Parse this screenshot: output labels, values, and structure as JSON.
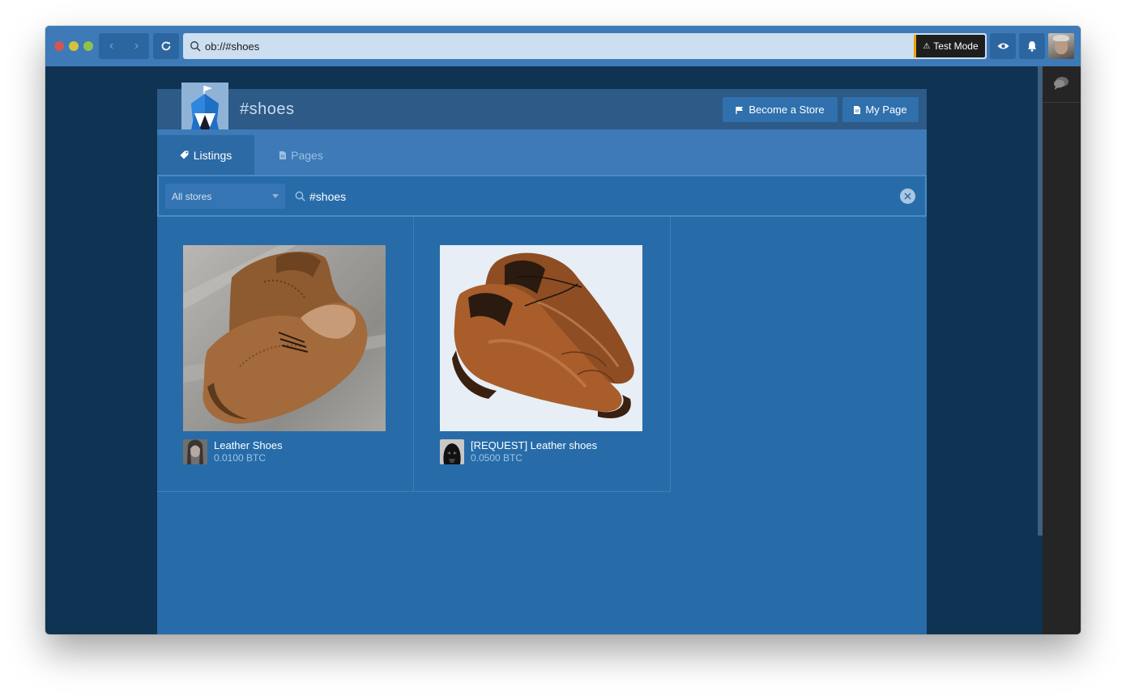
{
  "browser": {
    "address": "ob://#shoes",
    "test_mode_label": "Test Mode"
  },
  "page": {
    "title": "#shoes",
    "become_store_label": "Become a Store",
    "my_page_label": "My Page"
  },
  "tabs": [
    {
      "label": "Listings",
      "active": true
    },
    {
      "label": "Pages",
      "active": false
    }
  ],
  "search": {
    "store_filter": "All stores",
    "query": "#shoes"
  },
  "listings": [
    {
      "title": "Leather Shoes",
      "price": "0.0100 BTC"
    },
    {
      "title": "[REQUEST] Leather shoes",
      "price": "0.0500 BTC"
    }
  ],
  "colors": {
    "accent": "#3d7ab7",
    "panel": "#276ca9",
    "background": "#0f3352",
    "test_mode_stripe": "#f0a000"
  }
}
